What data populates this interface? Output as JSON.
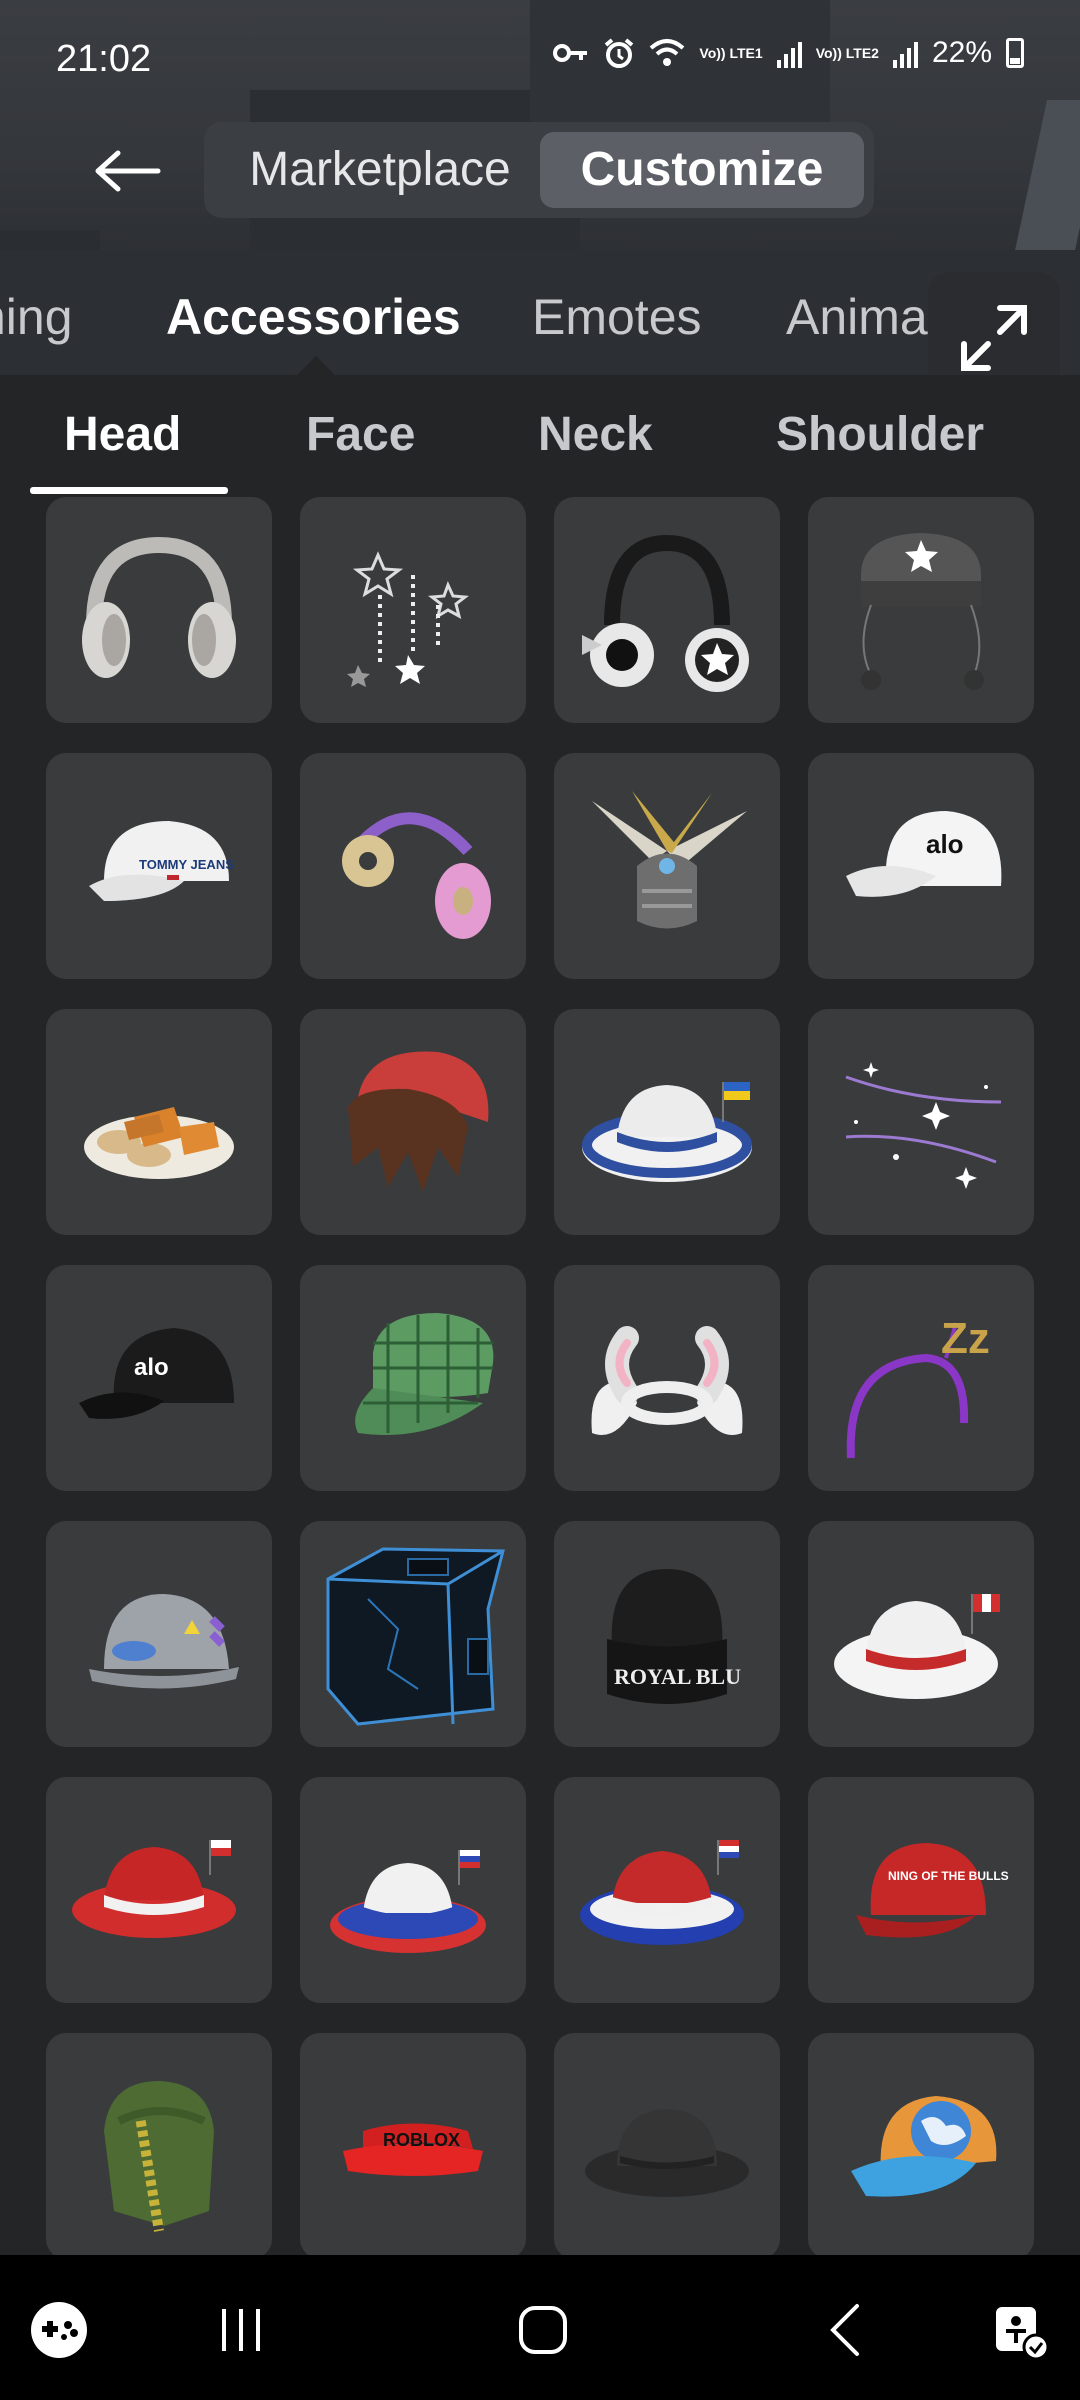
{
  "status_bar": {
    "time": "21:02",
    "sim1": "Vo)) LTE1",
    "sim2": "Vo)) LTE2",
    "battery": "22%"
  },
  "header": {
    "back_icon": "arrow-left-icon",
    "tabs": [
      {
        "label": "Marketplace",
        "selected": false
      },
      {
        "label": "Customize",
        "selected": true
      }
    ]
  },
  "categories": {
    "items": [
      {
        "label": "ning",
        "active": false
      },
      {
        "label": "Accessories",
        "active": true
      },
      {
        "label": "Emotes",
        "active": false
      },
      {
        "label": "Anima",
        "active": false
      }
    ],
    "expand_icon": "expand-icon"
  },
  "subcategories": {
    "items": [
      {
        "label": "Head",
        "active": true
      },
      {
        "label": "Face",
        "active": false
      },
      {
        "label": "Neck",
        "active": false
      },
      {
        "label": "Shoulder",
        "active": false
      }
    ]
  },
  "items_grid": [
    {
      "icon": "white-headphones-icon",
      "text": ""
    },
    {
      "icon": "star-chains-icon",
      "text": ""
    },
    {
      "icon": "black-star-headphones-icon",
      "text": ""
    },
    {
      "icon": "star-beanie-icon",
      "text": ""
    },
    {
      "icon": "white-cap-icon",
      "text": "TOMMY JEANS"
    },
    {
      "icon": "donut-headphones-icon",
      "text": ""
    },
    {
      "icon": "winged-helmet-icon",
      "text": ""
    },
    {
      "icon": "alo-white-cap-icon",
      "text": "alo"
    },
    {
      "icon": "pastry-plate-icon",
      "text": ""
    },
    {
      "icon": "red-beanie-hair-icon",
      "text": ""
    },
    {
      "icon": "ukraine-fedora-icon",
      "text": ""
    },
    {
      "icon": "sparkle-trail-icon",
      "text": ""
    },
    {
      "icon": "alo-black-cap-icon",
      "text": "alo"
    },
    {
      "icon": "plaid-cap-icon",
      "text": ""
    },
    {
      "icon": "bunny-ears-icon",
      "text": ""
    },
    {
      "icon": "zzz-headband-icon",
      "text": "Zz"
    },
    {
      "icon": "hard-hat-icon",
      "text": ""
    },
    {
      "icon": "neon-box-icon",
      "text": ""
    },
    {
      "icon": "royal-blu-beanie-icon",
      "text": "ROYAL BLU"
    },
    {
      "icon": "peru-fedora-icon",
      "text": ""
    },
    {
      "icon": "red-fedora-icon",
      "text": ""
    },
    {
      "icon": "russia-fedora-icon",
      "text": ""
    },
    {
      "icon": "netherlands-fedora-icon",
      "text": ""
    },
    {
      "icon": "bulls-cap-icon",
      "text": "NING OF THE BULLS"
    },
    {
      "icon": "green-hood-icon",
      "text": ""
    },
    {
      "icon": "roblox-visor-icon",
      "text": "ROBLOX"
    },
    {
      "icon": "black-bowler-icon",
      "text": ""
    },
    {
      "icon": "globe-cap-icon",
      "text": ""
    }
  ],
  "bottom_nav": [
    "game-controller-icon",
    "recent-apps-icon",
    "home-icon",
    "back-icon",
    "accessibility-icon"
  ],
  "colors": {
    "background": "#232527",
    "tile": "#393b3d",
    "toggle_bg": "#3b3e43",
    "toggle_selected": "#5c6066"
  }
}
